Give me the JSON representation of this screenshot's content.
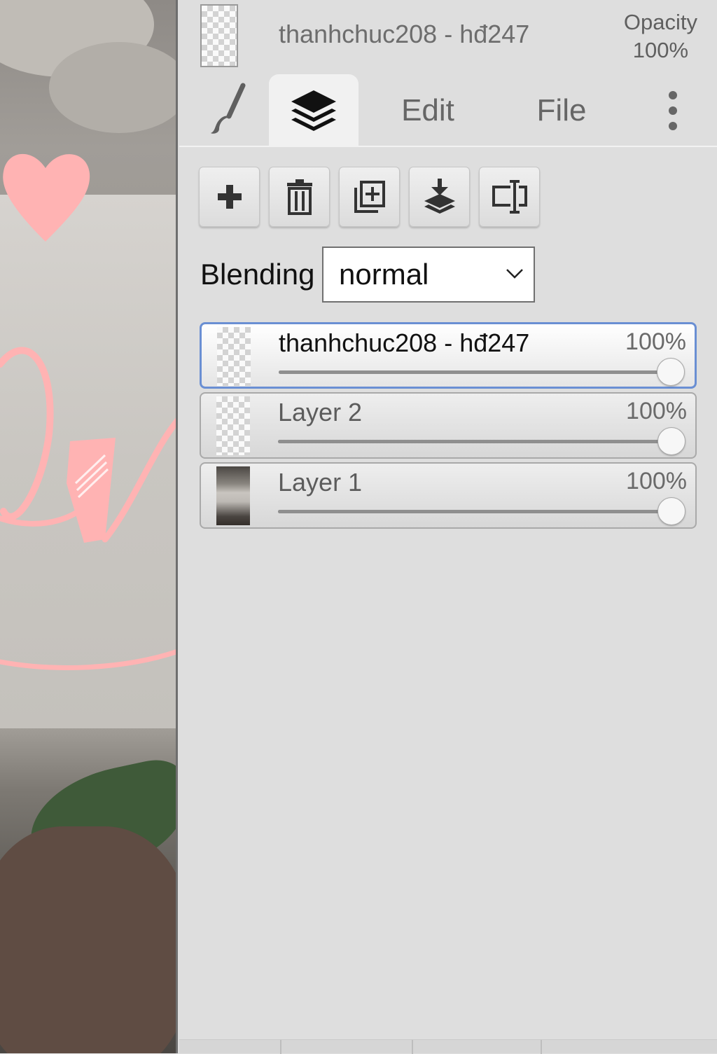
{
  "header": {
    "layer_name": "thanhchuc208 - hđ247",
    "opacity_label": "Opacity",
    "opacity_value": "100%"
  },
  "tabs": {
    "brush_icon": "brush-icon",
    "layers_icon": "layers-icon",
    "edit_label": "Edit",
    "file_label": "File",
    "more_icon": "more-vertical-icon",
    "active": "layers"
  },
  "toolbar": {
    "buttons": [
      {
        "icon": "add-layer-icon"
      },
      {
        "icon": "delete-layer-icon"
      },
      {
        "icon": "duplicate-layer-icon"
      },
      {
        "icon": "merge-down-icon"
      },
      {
        "icon": "rename-layer-icon"
      }
    ]
  },
  "blending": {
    "label": "Blending",
    "value": "normal"
  },
  "layers": [
    {
      "name": "thanhchuc208 - hđ247",
      "opacity_text": "100%",
      "opacity": 1.0,
      "selected": true,
      "thumb": "transparent"
    },
    {
      "name": "Layer 2",
      "opacity_text": "100%",
      "opacity": 1.0,
      "selected": false,
      "thumb": "transparent"
    },
    {
      "name": "Layer 1",
      "opacity_text": "100%",
      "opacity": 1.0,
      "selected": false,
      "thumb": "photo"
    }
  ],
  "colors": {
    "accent_pink": "#ffb3b3",
    "selected_border": "#6a8fd3",
    "panel_bg": "#dedede"
  }
}
